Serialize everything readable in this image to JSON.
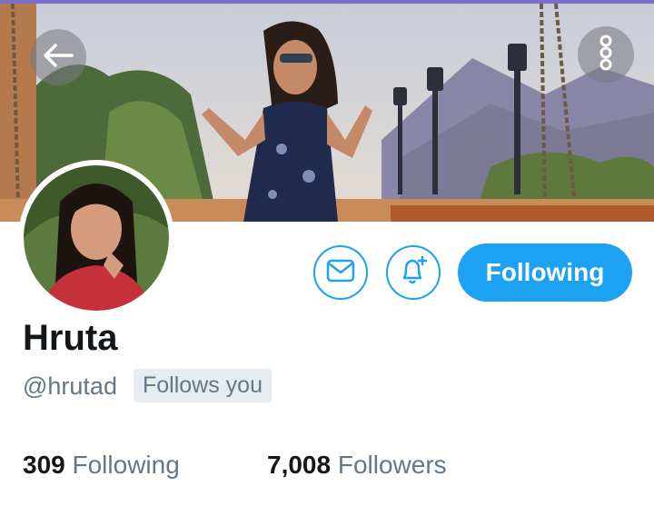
{
  "profile": {
    "name": "Hruta",
    "handle": "@hrutad",
    "follows_you_badge": "Follows you",
    "following_count": "309",
    "following_label": "Following",
    "followers_count": "7,008",
    "followers_label": "Followers"
  },
  "actions": {
    "follow_button_label": "Following",
    "back_icon": "arrow-left-icon",
    "more_icon": "vertical-dots-icon",
    "message_icon": "envelope-icon",
    "notify_icon": "bell-plus-icon"
  },
  "colors": {
    "accent": "#1da1f2",
    "primary_text": "#14171a",
    "secondary_text": "#657786",
    "badge_bg": "#e6ecf0"
  }
}
